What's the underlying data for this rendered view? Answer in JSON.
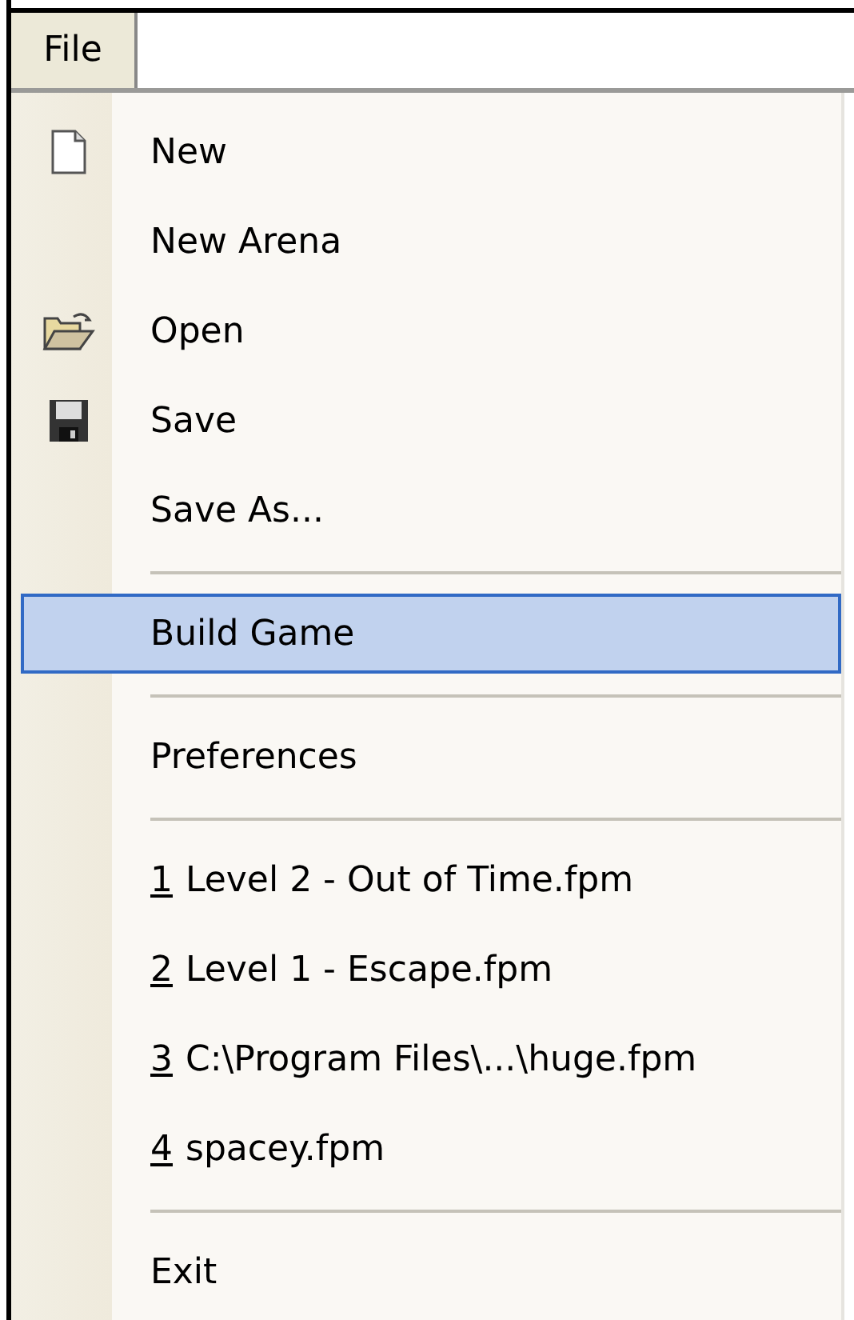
{
  "menubar": {
    "items": [
      {
        "label": "File",
        "selected": true
      }
    ]
  },
  "menu": {
    "items": [
      {
        "kind": "item",
        "label": "New",
        "selected": false
      },
      {
        "kind": "item",
        "label": "New Arena",
        "selected": false
      },
      {
        "kind": "item",
        "label": "Open",
        "selected": false
      },
      {
        "kind": "item",
        "label": "Save",
        "selected": false
      },
      {
        "kind": "item",
        "label": "Save As...",
        "selected": false
      },
      {
        "kind": "separator"
      },
      {
        "kind": "item",
        "label": "Build Game",
        "selected": true
      },
      {
        "kind": "separator"
      },
      {
        "kind": "item",
        "label": "Preferences",
        "selected": false
      },
      {
        "kind": "separator"
      },
      {
        "kind": "item",
        "mnemonic": "1",
        "label": "Level 2 - Out of Time.fpm",
        "selected": false
      },
      {
        "kind": "item",
        "mnemonic": "2",
        "label": "Level 1 - Escape.fpm",
        "selected": false
      },
      {
        "kind": "item",
        "mnemonic": "3",
        "label": "C:\\Program Files\\...\\huge.fpm",
        "selected": false
      },
      {
        "kind": "item",
        "mnemonic": "4",
        "label": "spacey.fpm",
        "selected": false
      },
      {
        "kind": "separator"
      },
      {
        "kind": "item",
        "label": "Exit",
        "selected": false
      }
    ]
  }
}
